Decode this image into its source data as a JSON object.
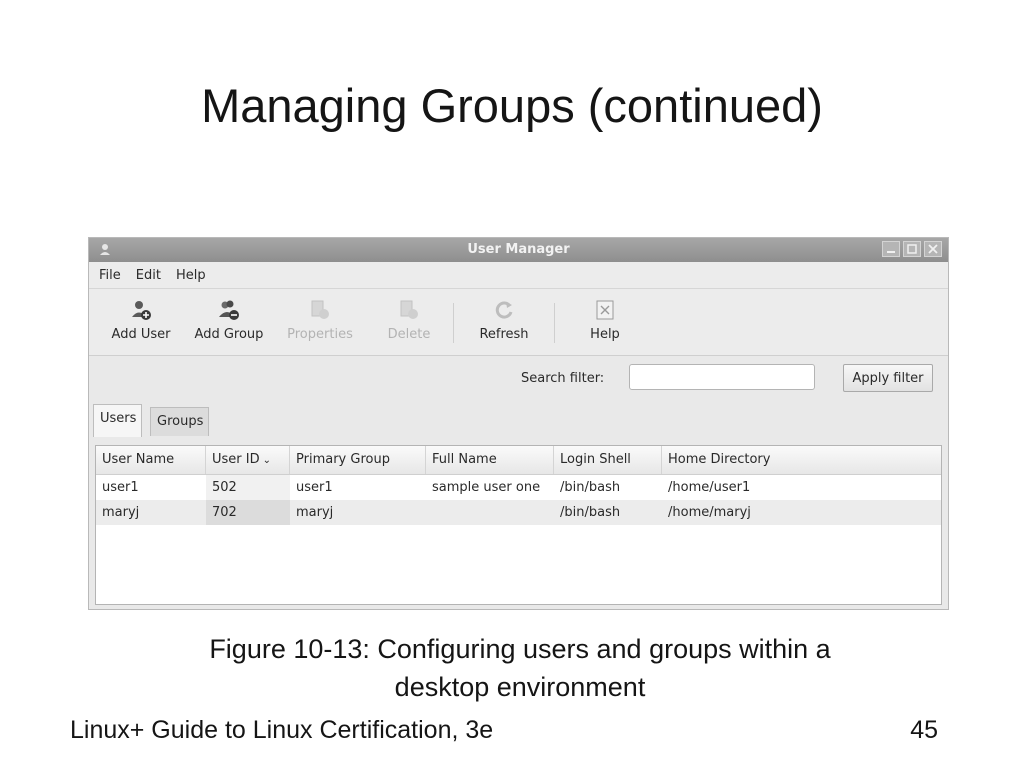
{
  "slide": {
    "title": "Managing Groups (continued)",
    "caption_line1": "Figure 10-13: Configuring users and groups within a",
    "caption_line2": "desktop environment",
    "footer_left": "Linux+ Guide to Linux Certification, 3e",
    "page_number": "45"
  },
  "window": {
    "title": "User Manager",
    "icon": "user-manager-icon",
    "controls": [
      "minimize-icon",
      "maximize-icon",
      "close-icon"
    ]
  },
  "menu": [
    "File",
    "Edit",
    "Help"
  ],
  "toolbar": {
    "buttons": [
      {
        "label": "Add User",
        "icon": "add-user-icon",
        "enabled": true
      },
      {
        "label": "Add Group",
        "icon": "add-group-icon",
        "enabled": true
      },
      {
        "label": "Properties",
        "icon": "properties-icon",
        "enabled": false
      },
      {
        "label": "Delete",
        "icon": "delete-icon",
        "enabled": false
      },
      {
        "label": "Refresh",
        "icon": "refresh-icon",
        "enabled": true
      },
      {
        "label": "Help",
        "icon": "help-icon",
        "enabled": true
      }
    ]
  },
  "filter": {
    "label": "Search filter:",
    "value": "",
    "apply_label": "Apply filter"
  },
  "tabs": [
    "Users",
    "Groups"
  ],
  "active_tab": "Users",
  "table": {
    "columns": [
      "User Name",
      "User ID",
      "Primary Group",
      "Full Name",
      "Login Shell",
      "Home Directory"
    ],
    "sorted_column": "User ID",
    "rows": [
      [
        "user1",
        "502",
        "user1",
        "sample user one",
        "/bin/bash",
        "/home/user1"
      ],
      [
        "maryj",
        "702",
        "maryj",
        "",
        "/bin/bash",
        "/home/maryj"
      ]
    ]
  },
  "colors": {
    "titlebar": "#9a9a9a",
    "window_bg": "#e9e9e9",
    "disabled_text": "#b3b3b3"
  }
}
